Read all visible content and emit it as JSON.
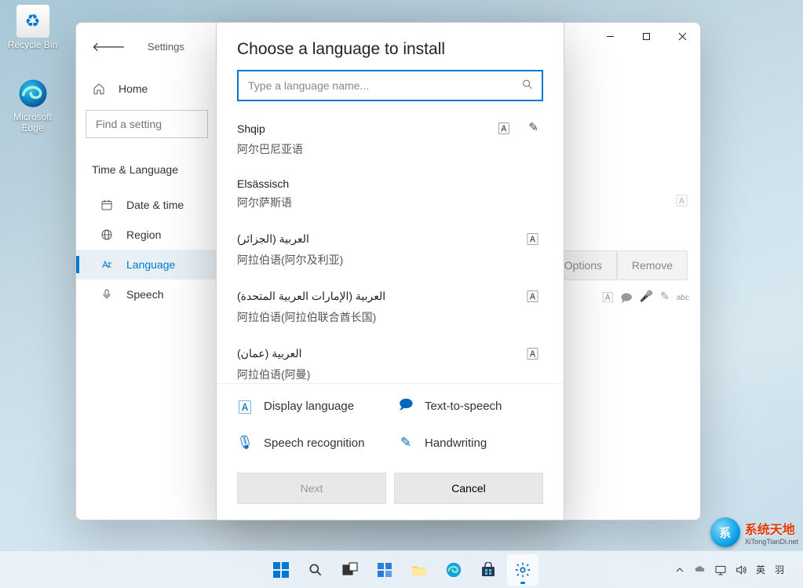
{
  "desktop": {
    "recycle_bin": "Recycle Bin",
    "edge": "Microsoft Edge"
  },
  "settings_window": {
    "back_label": "Settings",
    "find_placeholder": "Find a setting",
    "nav": {
      "home": "Home",
      "category": "Time & Language",
      "date_time": "Date & time",
      "region": "Region",
      "language": "Language",
      "speech": "Speech"
    },
    "buttons": {
      "options": "Options",
      "remove": "Remove"
    }
  },
  "dialog": {
    "title": "Choose a language to install",
    "search_placeholder": "Type a language name...",
    "languages": [
      {
        "native": "Shqip",
        "local": "阿尔巴尼亚语",
        "features": [
          "display",
          "handwriting"
        ]
      },
      {
        "native": "Elsässisch",
        "local": "阿尔萨斯语",
        "features": []
      },
      {
        "native": "العربية (الجزائر)",
        "local": "阿拉伯语(阿尔及利亚)",
        "features": [
          "display"
        ]
      },
      {
        "native": "العربية (الإمارات العربية المتحدة)",
        "local": "阿拉伯语(阿拉伯联合酋长国)",
        "features": [
          "display"
        ]
      },
      {
        "native": "العربية (عمان)",
        "local": "阿拉伯语(阿曼)",
        "features": [
          "display"
        ]
      }
    ],
    "legend": {
      "display": "Display language",
      "tts": "Text-to-speech",
      "speech": "Speech recognition",
      "handwriting": "Handwriting"
    },
    "buttons": {
      "next": "Next",
      "cancel": "Cancel"
    }
  },
  "taskbar": {
    "ime1": "英",
    "ime2": "羽"
  },
  "brand": {
    "line1": "系统天地",
    "line2": "XiTongTianDi.net"
  }
}
